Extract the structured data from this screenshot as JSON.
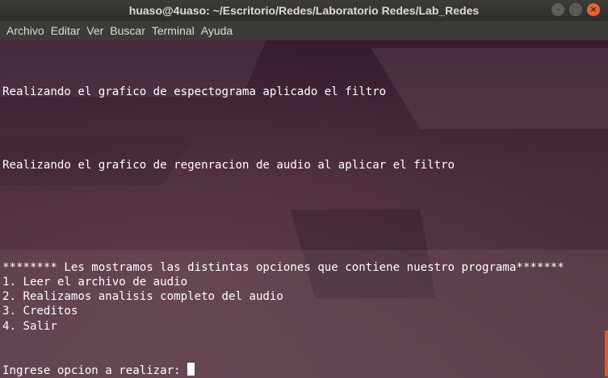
{
  "window": {
    "title": "huaso@4uaso: ~/Escritorio/Redes/Laboratorio Redes/Lab_Redes",
    "controls": {
      "minimize": "–",
      "maximize": "□",
      "close": "×"
    }
  },
  "menu": {
    "items": [
      "Archivo",
      "Editar",
      "Ver",
      "Buscar",
      "Terminal",
      "Ayuda"
    ]
  },
  "terminal": {
    "lines": [
      "",
      "",
      "",
      "Realizando el grafico de espectograma aplicado el filtro",
      "",
      "",
      "",
      "",
      "Realizando el grafico de regenracion de audio al aplicar el filtro",
      "",
      "",
      "",
      "",
      "",
      "",
      "******** Les mostramos las distintas opciones que contiene nuestro programa*******",
      "1. Leer el archivo de audio",
      "2. Realizamos analisis completo del audio",
      "3. Creditos",
      "4. Salir",
      "",
      "",
      "Ingrese opcion a realizar: "
    ]
  },
  "colors": {
    "accent": "#e95420",
    "terminal_text": "#ffffff",
    "titlebar_bg": "#3c3b37"
  },
  "icons": {
    "minimize": "minimize-icon",
    "maximize": "maximize-icon",
    "close": "close-icon"
  }
}
